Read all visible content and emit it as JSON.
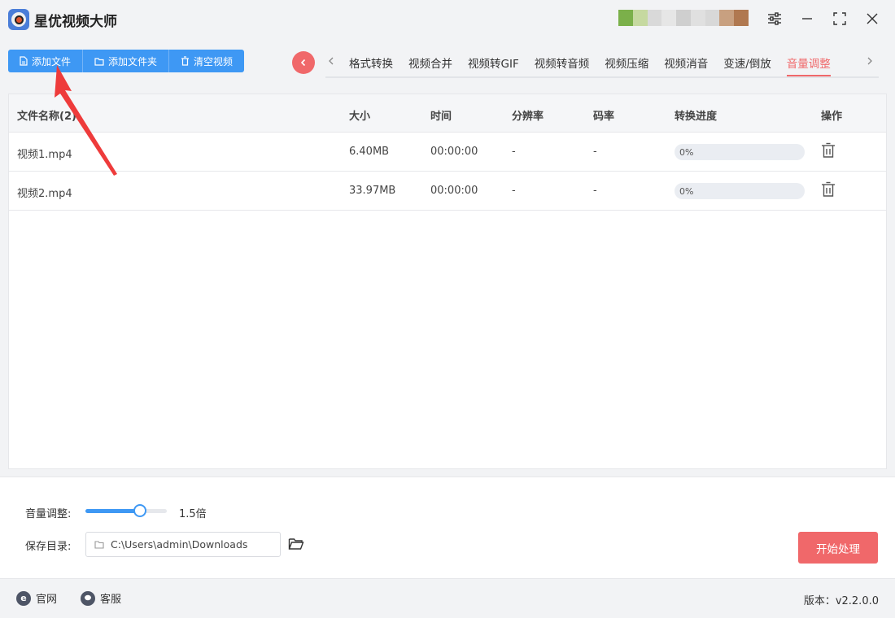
{
  "app": {
    "title": "星优视频大师",
    "avatar_colors": [
      "#7bb04a",
      "#c6d9a0",
      "#d9d9d9",
      "#e6e6e6",
      "#cfcfcf",
      "#e0e0e0",
      "#d8d8d8",
      "#c8a080",
      "#b07850"
    ]
  },
  "toolbar": {
    "add_file": "添加文件",
    "add_folder": "添加文件夹",
    "clear_videos": "清空视频"
  },
  "tabs": [
    {
      "label": "格式转换",
      "active": false
    },
    {
      "label": "视频合并",
      "active": false
    },
    {
      "label": "视频转GIF",
      "active": false
    },
    {
      "label": "视频转音频",
      "active": false
    },
    {
      "label": "视频压缩",
      "active": false
    },
    {
      "label": "视频消音",
      "active": false
    },
    {
      "label": "变速/倒放",
      "active": false
    },
    {
      "label": "音量调整",
      "active": true
    }
  ],
  "table": {
    "headers": {
      "name": "文件名称(2)",
      "size": "大小",
      "time": "时间",
      "resolution": "分辨率",
      "bitrate": "码率",
      "progress": "转换进度",
      "action": "操作"
    },
    "rows": [
      {
        "name": "视频1.mp4",
        "size": "6.40MB",
        "time": "00:00:00",
        "resolution": "-",
        "bitrate": "-",
        "progress_text": "0%",
        "progress": 0
      },
      {
        "name": "视频2.mp4",
        "size": "33.97MB",
        "time": "00:00:00",
        "resolution": "-",
        "bitrate": "-",
        "progress_text": "0%",
        "progress": 0
      }
    ]
  },
  "settings": {
    "volume_label": "音量调整:",
    "volume_value": "1.5倍",
    "volume_fraction": 0.67,
    "save_label": "保存目录:",
    "save_path": "C:\\Users\\admin\\Downloads",
    "start_button": "开始处理"
  },
  "footer": {
    "website": "官网",
    "support": "客服",
    "version": "版本：v2.2.0.0"
  },
  "colors": {
    "accent_blue": "#3e98f4",
    "accent_red": "#f0686a"
  }
}
